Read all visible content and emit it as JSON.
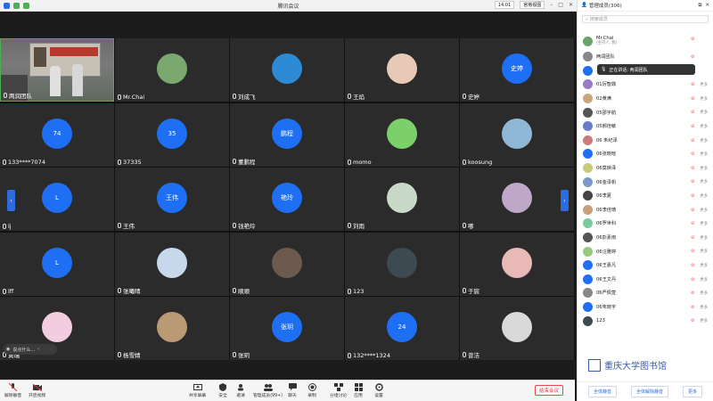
{
  "window": {
    "title": "腾讯会议",
    "time": "14:01",
    "view_label": "宫格视图"
  },
  "tiles": [
    {
      "name": "两润团队",
      "kind": "scene"
    },
    {
      "name": "Mr.Chai",
      "kind": "photo",
      "color": "#7aa86f"
    },
    {
      "name": "刘成飞",
      "kind": "photo",
      "color": "#2d8bd6"
    },
    {
      "name": "王焰",
      "kind": "photo",
      "color": "#e8c9b7"
    },
    {
      "name": "史婷",
      "kind": "blue",
      "label": "史婷"
    },
    {
      "name": "133****7074",
      "kind": "blue",
      "label": "74"
    },
    {
      "name": "37335",
      "kind": "blue",
      "label": "35"
    },
    {
      "name": "董鹏程",
      "kind": "blue",
      "label": "鹏程"
    },
    {
      "name": "momo",
      "kind": "photo",
      "color": "#7bd06b"
    },
    {
      "name": "koosung",
      "kind": "photo",
      "color": "#8fb7d6"
    },
    {
      "name": "lj",
      "kind": "blue",
      "label": "L"
    },
    {
      "name": "王伟",
      "kind": "blue",
      "label": "王伟"
    },
    {
      "name": "钱艳玲",
      "kind": "blue",
      "label": "艳玲"
    },
    {
      "name": "刘雨",
      "kind": "photo",
      "color": "#c9d9c7"
    },
    {
      "name": "嘟",
      "kind": "photo",
      "color": "#bfa7c9"
    },
    {
      "name": "lff",
      "kind": "blue",
      "label": "L"
    },
    {
      "name": "张曦晴",
      "kind": "photo",
      "color": "#c7d8ec"
    },
    {
      "name": "顺顺",
      "kind": "photo",
      "color": "#6b5a4d"
    },
    {
      "name": "123",
      "kind": "photo",
      "color": "#3d4a52"
    },
    {
      "name": "于宸",
      "kind": "photo",
      "color": "#e8b9b6"
    },
    {
      "name": "黄瑞",
      "kind": "photo",
      "color": "#f2cde0"
    },
    {
      "name": "杨雪婧",
      "kind": "photo",
      "color": "#b99a74"
    },
    {
      "name": "张玥",
      "kind": "blue",
      "label": "张玥"
    },
    {
      "name": "132****1324",
      "kind": "blue",
      "label": "24"
    },
    {
      "name": "曾洁",
      "kind": "photo",
      "color": "#d9d9d9"
    }
  ],
  "chat_pill": "说点什么...",
  "toolbar": {
    "mute": "解除静音",
    "video": "开启视频",
    "share": "共享屏幕",
    "security": "安全",
    "invite": "邀请",
    "members": "管理成员(99+)",
    "chat": "聊天",
    "record": "录制",
    "group": "分组讨论",
    "apps": "应用",
    "settings": "设置",
    "end": "结束会议"
  },
  "panel": {
    "title": "管理成员(306)",
    "search_placeholder": "搜索成员",
    "speaking_tip": "正在讲话: 两润团队",
    "members": [
      {
        "name": "Mr.Chai",
        "sub": "(主持人, 我)",
        "color": "#6aa36b",
        "status": ""
      },
      {
        "name": "两润团队",
        "color": "#888",
        "status": ""
      },
      {
        "name": "...",
        "color": "#1f6ff5",
        "status": ""
      },
      {
        "name": "01厉智鼎",
        "color": "#9a7cc9",
        "status": "更多"
      },
      {
        "name": "02黄满",
        "color": "#c9a77c",
        "status": "更多"
      },
      {
        "name": "05邵宇航",
        "color": "#555",
        "status": "更多"
      },
      {
        "name": "05郝佳敏",
        "color": "#6b7cc9",
        "status": "更多"
      },
      {
        "name": "06 朱纪泽",
        "color": "#c97c7c",
        "status": "更多"
      },
      {
        "name": "06张晓晗",
        "color": "#1f6ff5",
        "status": "更多"
      },
      {
        "name": "06莫映泽",
        "color": "#c9c97c",
        "status": "更多"
      },
      {
        "name": "06金泽帆",
        "color": "#7c9ac9",
        "status": "更多"
      },
      {
        "name": "06李夏",
        "color": "#444",
        "status": "更多"
      },
      {
        "name": "06李佳琦",
        "color": "#c9a07c",
        "status": "更多"
      },
      {
        "name": "06罗世科",
        "color": "#7cc99a",
        "status": "更多"
      },
      {
        "name": "06彭素雨",
        "color": "#555",
        "status": "更多"
      },
      {
        "name": "06汪雅婷",
        "color": "#9ac97c",
        "status": "更多"
      },
      {
        "name": "06王嘉凡",
        "color": "#1f6ff5",
        "status": "更多"
      },
      {
        "name": "06王文丹",
        "color": "#1f6ff5",
        "status": "更多"
      },
      {
        "name": "06严佩萱",
        "color": "#888",
        "status": "更多"
      },
      {
        "name": "06朱晓宇",
        "color": "#1f6ff5",
        "status": "更多"
      },
      {
        "name": "123",
        "color": "#3d4a52",
        "status": "更多"
      }
    ],
    "mute_all": "全体静音",
    "unmute_all": "全体解除静音",
    "more": "更多"
  },
  "watermark": "重庆大学图书馆"
}
